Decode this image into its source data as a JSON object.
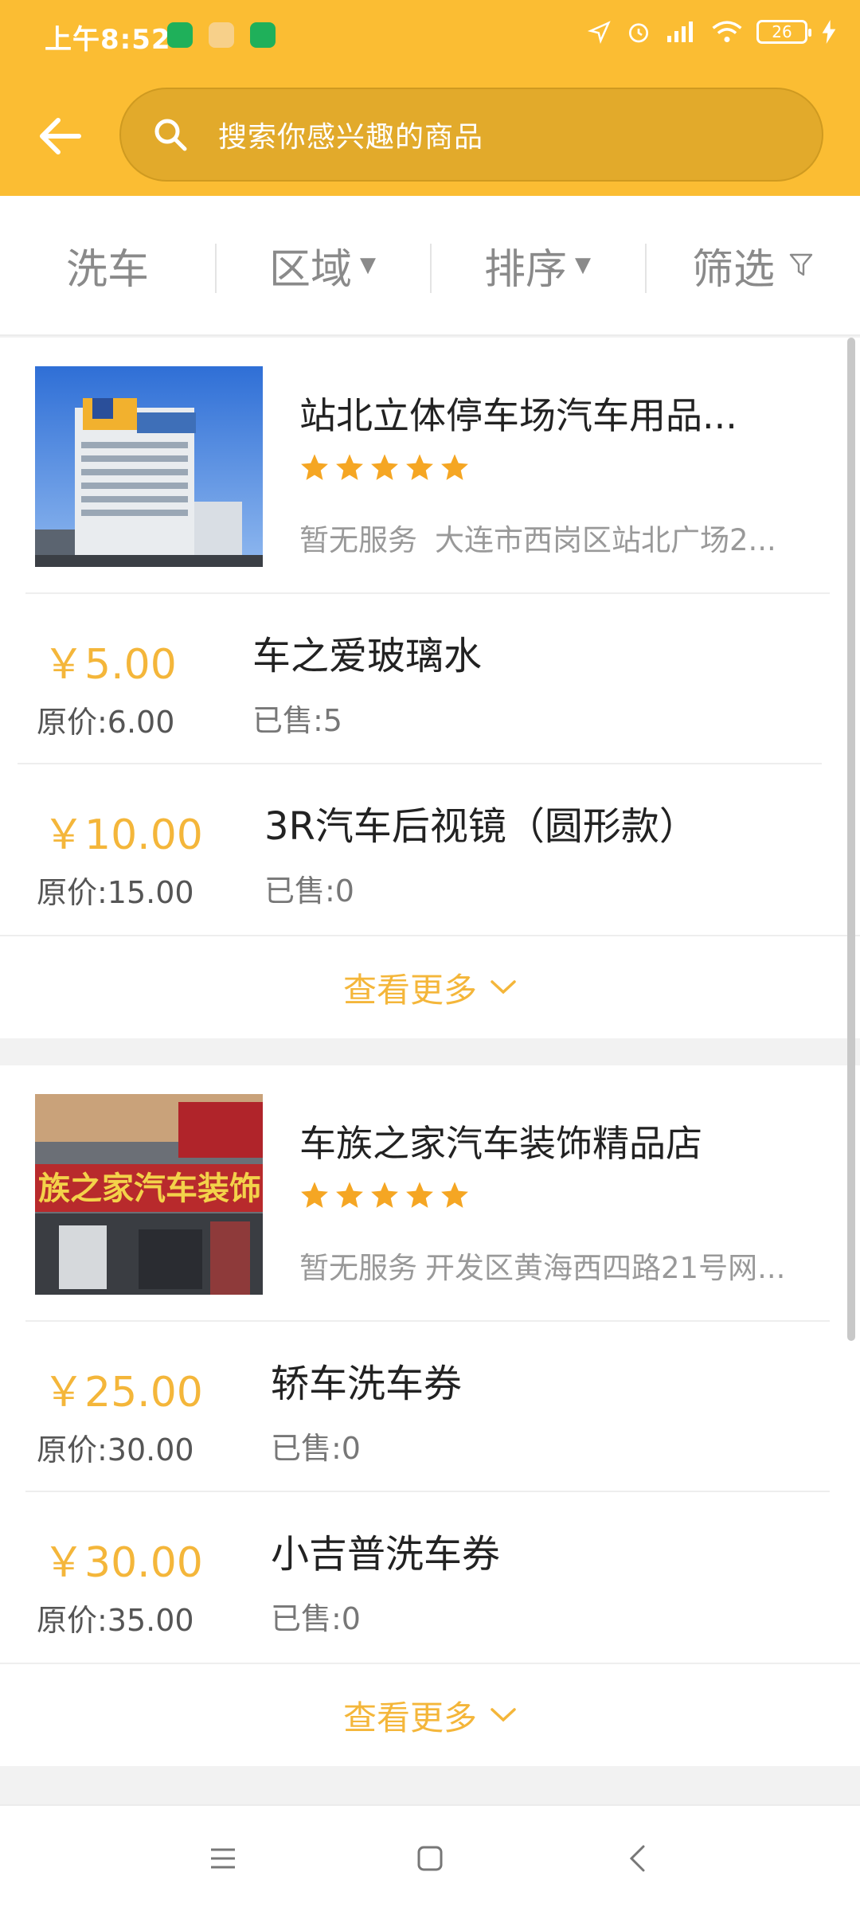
{
  "status_bar": {
    "time": "上午8:52",
    "battery": "26"
  },
  "search": {
    "placeholder": "搜索你感兴趣的商品"
  },
  "filters": {
    "category": "洗车",
    "area": "区域",
    "sort": "排序",
    "filter": "筛选"
  },
  "shops": [
    {
      "name": "站北立体停车场汽车用品...",
      "rating": 5,
      "service": "暂无服务",
      "address": "大连市西岗区站北广场2...",
      "items": [
        {
          "price": "￥5.00",
          "original": "原价:6.00",
          "name": "车之爱玻璃水",
          "sold": "已售:5"
        },
        {
          "price": "￥10.00",
          "original": "原价:15.00",
          "name": "3R汽车后视镜（圆形款）",
          "sold": "已售:0"
        }
      ],
      "more": "查看更多"
    },
    {
      "name": "车族之家汽车装饰精品店",
      "rating": 5,
      "service": "暂无服务",
      "address": "开发区黄海西四路21号网...",
      "sign_text": "族之家汽车装饰",
      "items": [
        {
          "price": "￥25.00",
          "original": "原价:30.00",
          "name": "轿车洗车券",
          "sold": "已售:0"
        },
        {
          "price": "￥30.00",
          "original": "原价:35.00",
          "name": "小吉普洗车券",
          "sold": "已售:0"
        }
      ],
      "more": "查看更多"
    }
  ],
  "colors": {
    "header": "#fbbd33",
    "accent": "#f4b63a",
    "star": "#f5a623"
  }
}
